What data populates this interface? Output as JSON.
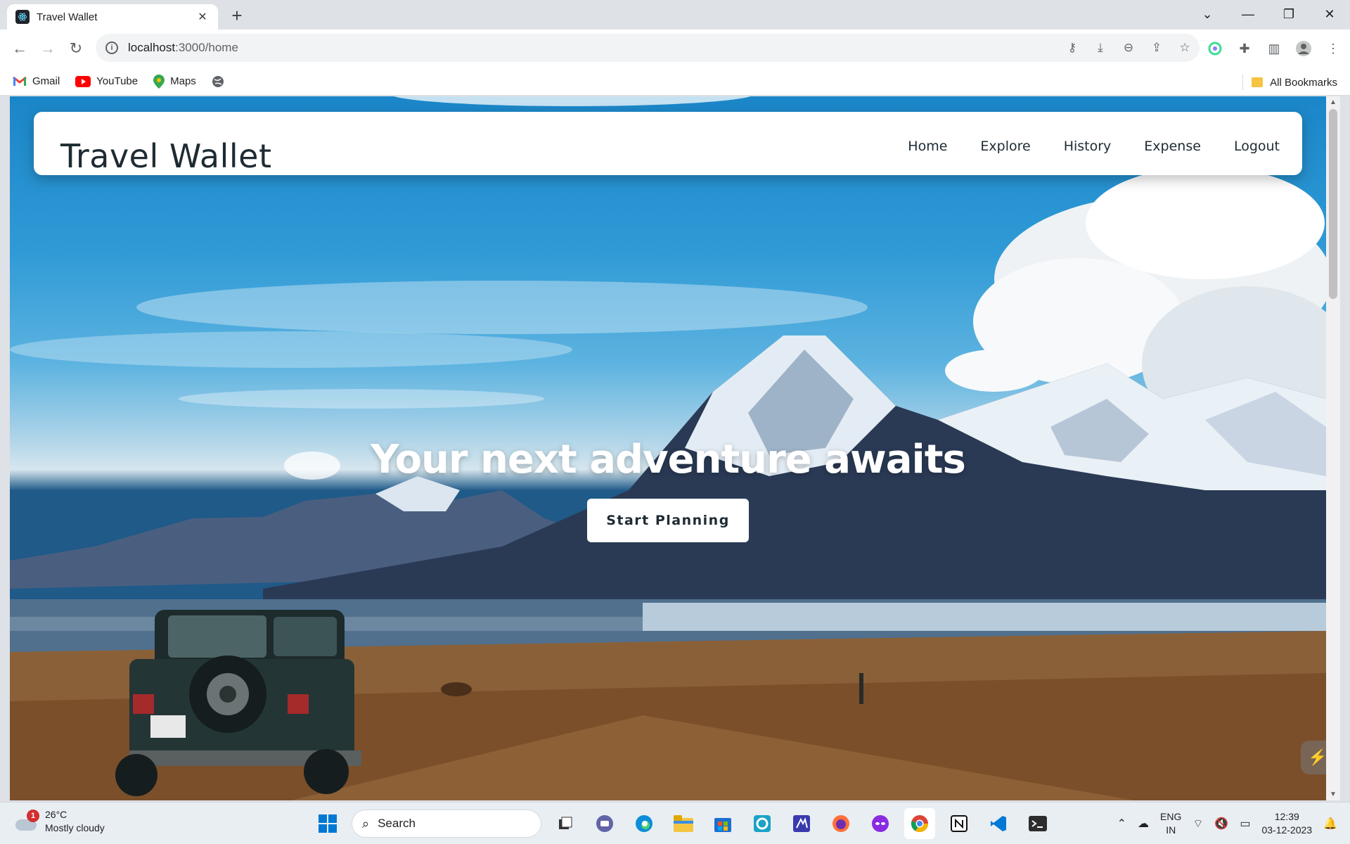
{
  "browser": {
    "tab_title": "Travel Wallet",
    "tab_close": "✕",
    "new_tab": "+",
    "url_host": "localhost",
    "url_path": ":3000/home",
    "bookmarks": [
      "Gmail",
      "YouTube",
      "Maps"
    ],
    "all_bookmarks": "All Bookmarks"
  },
  "app": {
    "brand": "Travel Wallet",
    "nav": [
      "Home",
      "Explore",
      "History",
      "Expense",
      "Logout"
    ],
    "hero_title": "Your next adventure awaits",
    "cta_label": "Start Planning"
  },
  "taskbar": {
    "temperature": "26°C",
    "weather": "Mostly cloudy",
    "weather_badge": "1",
    "search_label": "Search",
    "lang": "ENG",
    "region": "IN",
    "time": "12:39",
    "date": "03-12-2023"
  },
  "colors": {
    "brand_text": "#1e2b33",
    "accent_blue": "#1a86c8"
  }
}
